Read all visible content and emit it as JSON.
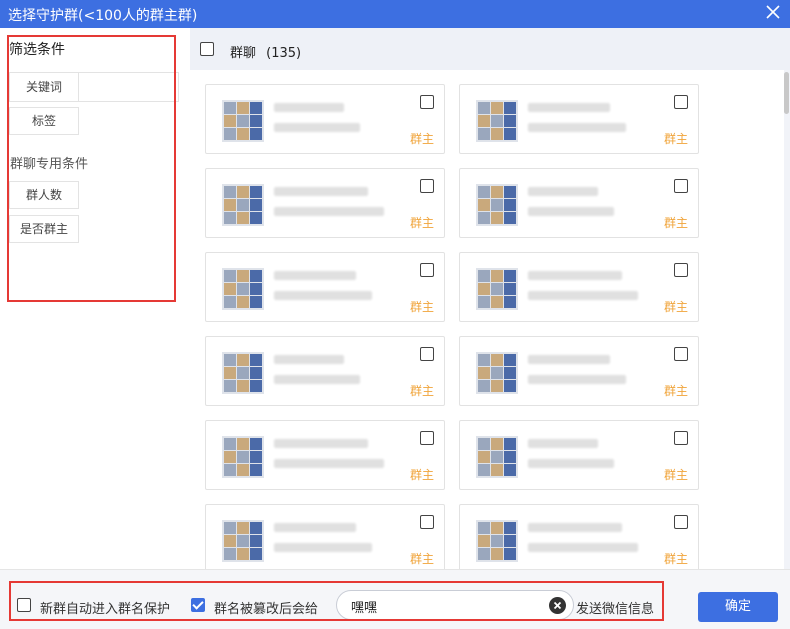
{
  "window": {
    "title": "选择守护群(<100人的群主群)"
  },
  "sidebar": {
    "heading": "筛选条件",
    "keyword_label": "关键词",
    "keyword_value": "",
    "tag_label": "标签",
    "group_section": "群聊专用条件",
    "member_count_label": "群人数",
    "is_owner_label": "是否群主"
  },
  "list": {
    "header_label": "群聊",
    "count": "(135)",
    "cards": [
      {
        "tag": "群主",
        "checked": false
      },
      {
        "tag": "群主",
        "checked": false
      },
      {
        "tag": "群主",
        "checked": false
      },
      {
        "tag": "群主",
        "checked": false
      },
      {
        "tag": "群主",
        "checked": false
      },
      {
        "tag": "群主",
        "checked": false
      },
      {
        "tag": "群主",
        "checked": false
      },
      {
        "tag": "群主",
        "checked": false
      },
      {
        "tag": "群主",
        "checked": false
      },
      {
        "tag": "群主",
        "checked": false
      },
      {
        "tag": "群主",
        "checked": false
      },
      {
        "tag": "群主",
        "checked": false
      }
    ]
  },
  "footer": {
    "auto_protect_label": "新群自动进入群名保护",
    "auto_protect_checked": false,
    "rename_notify_label": "群名被篡改后会给",
    "rename_notify_checked": true,
    "message_value": "嘿嘿",
    "send_suffix": "发送微信信息",
    "confirm_label": "确定"
  },
  "colors": {
    "accent": "#3d6fe1",
    "owner_tag": "#f0a43a",
    "highlight_frame": "#e53935"
  },
  "icons": {
    "close": "close-icon",
    "clear": "clear-circle-icon"
  }
}
